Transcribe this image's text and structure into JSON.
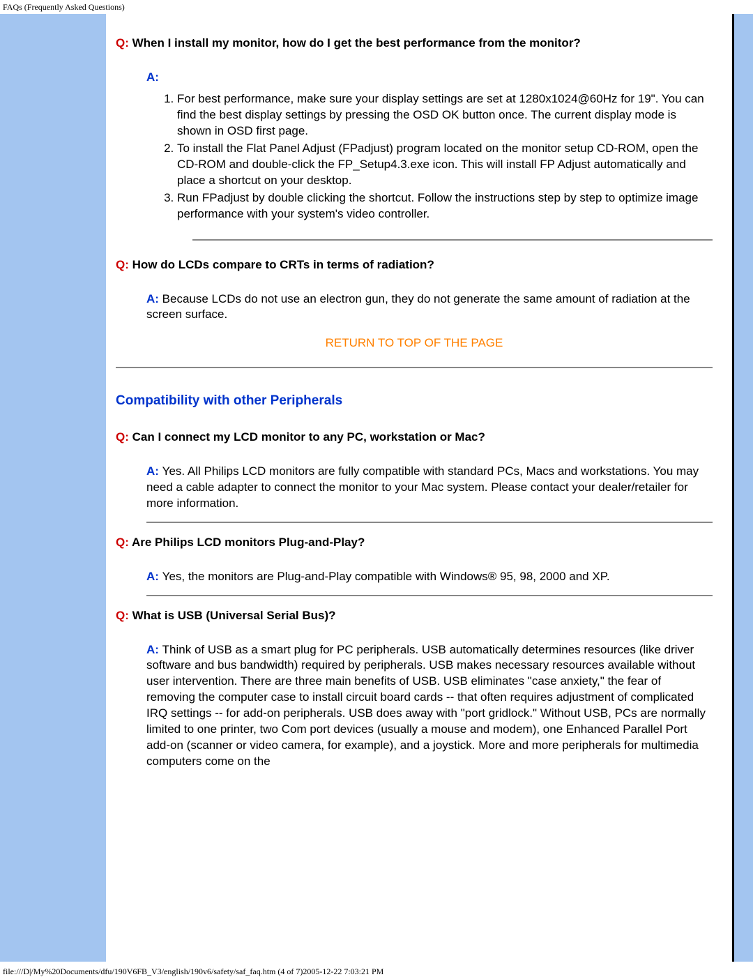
{
  "header": "FAQs (Frequently Asked Questions)",
  "labels": {
    "q": "Q:",
    "a": "A:"
  },
  "footer": "file:///D|/My%20Documents/dfu/190V6FB_V3/english/190v6/safety/saf_faq.htm (4 of 7)2005-12-22 7:03:21 PM",
  "return_link": "RETURN TO TOP OF THE PAGE",
  "faq1": {
    "q": "When I install my monitor, how do I get the best performance from the monitor?",
    "steps": {
      "s1": "For best performance, make sure your display settings are set at 1280x1024@60Hz for 19\". You can find the best display settings by pressing the OSD OK button once. The current display mode is shown in OSD first page.",
      "s2": "To install the Flat Panel Adjust (FPadjust) program located on the monitor setup CD-ROM, open the CD-ROM and double-click the FP_Setup4.3.exe icon. This will install FP Adjust automatically and place a shortcut on your desktop.",
      "s3": "Run FPadjust by double clicking the shortcut. Follow the instructions step by step to optimize image performance with your system's video controller."
    }
  },
  "faq2": {
    "q": "How do LCDs compare to CRTs in terms of radiation?",
    "a": "Because LCDs do not use an electron gun, they do not generate the same amount of radiation at the screen surface."
  },
  "section2": "Compatibility with other Peripherals",
  "faq3": {
    "q": "Can I connect my LCD monitor to any PC, workstation or Mac?",
    "a": "Yes. All Philips LCD monitors are fully compatible with standard PCs, Macs and workstations. You may need a cable adapter to connect the monitor to your Mac system. Please contact your dealer/retailer for more information."
  },
  "faq4": {
    "q": "Are Philips LCD monitors Plug-and-Play?",
    "a": "Yes, the monitors are Plug-and-Play compatible with Windows® 95, 98, 2000 and XP."
  },
  "faq5": {
    "q": "What is USB (Universal Serial Bus)?",
    "a": "Think of USB as a smart plug for PC peripherals. USB automatically determines resources (like driver software and bus bandwidth) required by peripherals. USB makes necessary resources available without user intervention. There are three main benefits of USB. USB eliminates \"case anxiety,\" the fear of removing the computer case to install circuit board cards -- that often requires adjustment of complicated IRQ settings -- for add-on peripherals. USB does away with \"port gridlock.\" Without USB, PCs are normally limited to one printer, two Com port devices (usually a mouse and modem), one Enhanced Parallel Port add-on (scanner or video camera, for example), and a joystick. More and more peripherals for multimedia computers come on the"
  }
}
